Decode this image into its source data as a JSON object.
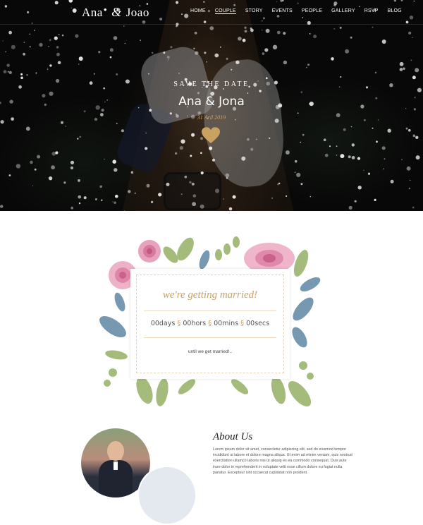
{
  "header": {
    "logo_left": "Ana",
    "logo_amp": "&",
    "logo_right": "Joao",
    "nav": [
      "HOME",
      "COUPLE",
      "STORY",
      "EVENTS",
      "PEOPLE",
      "GALLERY",
      "RSVP",
      "BLOG"
    ]
  },
  "hero": {
    "subtitle": "SAVE THE DATE",
    "names": "Ana & Jona",
    "date": "31 Aril 2019",
    "heart_color": "#c9a262"
  },
  "countdown": {
    "headline": "we're getting married!",
    "units": [
      {
        "value": "00",
        "label": "days"
      },
      {
        "value": "00",
        "label": "hors"
      },
      {
        "value": "00",
        "label": "mins"
      },
      {
        "value": "00",
        "label": "secs"
      }
    ],
    "footer": "until we get married!.."
  },
  "about": {
    "title": "About Us",
    "body": "Lorem ipsum dolor sit amet, consectetur adipiscing elit, sed do eiusmod tempor incididunt ut labore et dolore magna aliqua. Ut enim ad minim veniam, quis nostrud exercitation ullamco laboris nisi ut aliquip ex ea commodo consequat. Duis aute irure dolor in reprehenderit in voluptate velit esse cillum dolore eu fugiat nulla pariatur. Excepteur sint occaecat cupidatat non proident."
  },
  "colors": {
    "accent_gold": "#c9a262",
    "hero_bg": "#0d0d0d"
  }
}
